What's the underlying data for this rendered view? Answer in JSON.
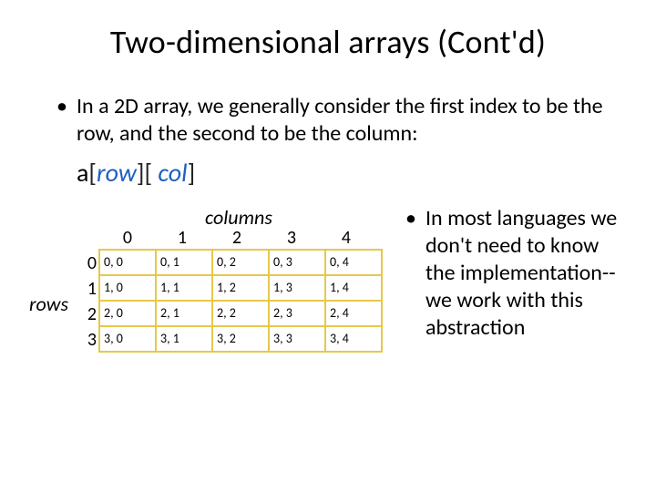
{
  "title": "Two-dimensional arrays (Cont'd)",
  "bullet_top": "In a 2D array, we generally consider the first index to be the row, and the second to be the column:",
  "code": {
    "a": "a",
    "lb1": "[",
    "row": "row",
    "rb1": "][",
    "space": " ",
    "col": "col",
    "rb2": "]"
  },
  "labels": {
    "columns": "columns",
    "rows": "rows"
  },
  "col_headers": [
    "0",
    "1",
    "2",
    "3",
    "4"
  ],
  "row_headers": [
    "0",
    "1",
    "2",
    "3"
  ],
  "cells": [
    [
      "0, 0",
      "0, 1",
      "0, 2",
      "0, 3",
      "0, 4"
    ],
    [
      "1, 0",
      "1, 1",
      "1, 2",
      "1, 3",
      "1, 4"
    ],
    [
      "2, 0",
      "2, 1",
      "2, 2",
      "2, 3",
      "2, 4"
    ],
    [
      "3, 0",
      "3, 1",
      "3, 2",
      "3, 3",
      "3, 4"
    ]
  ],
  "bullet_right": "In most languages we don't need to know the implementation-- we work with this abstraction",
  "dot": "•"
}
